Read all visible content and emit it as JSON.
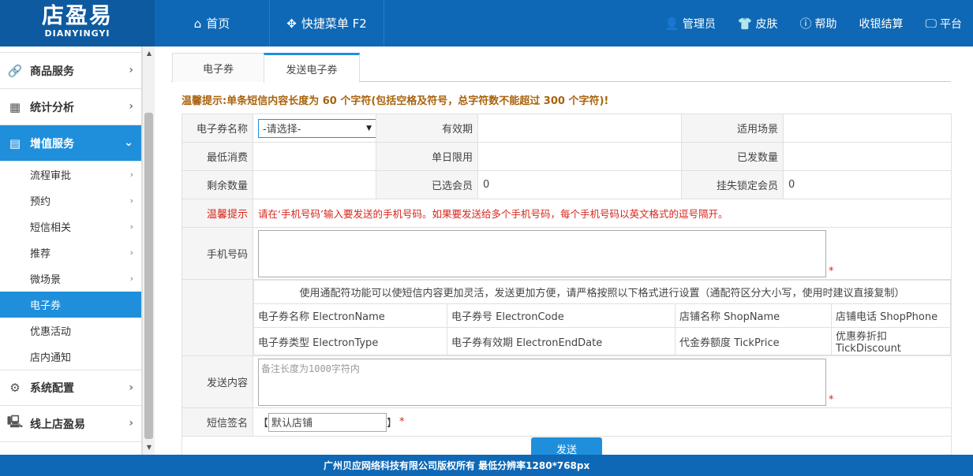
{
  "brand": {
    "name_cn": "店盈易",
    "name_en": "DIANYINGYI"
  },
  "top_nav": {
    "home": "首页",
    "quick_menu": "快捷菜单 F2"
  },
  "right_nav": {
    "admin": "管理员",
    "skin": "皮肤",
    "help": "帮助",
    "checkout": "收银结算",
    "platform": "平台"
  },
  "sidebar": {
    "groups": {
      "goods": "商品服务",
      "stats": "统计分析",
      "value_added": "增值服务",
      "system": "系统配置",
      "online": "线上店盈易"
    },
    "sub_items": [
      "流程审批",
      "预约",
      "短信相关",
      "推荐",
      "微场景",
      "电子券",
      "优惠活动",
      "店内通知"
    ]
  },
  "tabs": [
    "电子券",
    "发送电子券"
  ],
  "tip": "温馨提示:单条短信内容长度为 60 个字符(包括空格及符号，总字符数不能超过 300 个字符)!",
  "form": {
    "coupon_name_label": "电子券名称",
    "coupon_select_value": "-请选择-",
    "validity_label": "有效期",
    "scene_label": "适用场景",
    "min_spend_label": "最低消费",
    "daily_limit_label": "单日限用",
    "issued_label": "已发数量",
    "remaining_label": "剩余数量",
    "selected_members_label": "已选会员",
    "selected_members_value": "0",
    "locked_members_label": "挂失锁定会员",
    "locked_members_value": "0",
    "warm_tip_label": "温馨提示",
    "warm_tip_text": "请在‘手机号码’输入要发送的手机号码。如果要发送给多个手机号码，每个手机号码以英文格式的逗号隔开。",
    "phone_label": "手机号码",
    "required_mark": "*",
    "wildcard_head": "使用通配符功能可以使短信内容更加灵活，发送更加方便，请严格按照以下格式进行设置（通配符区分大小写，使用时建议直接复制）",
    "wildcards": [
      [
        "电子券名称 ElectronName",
        "电子券号 ElectronCode",
        "店铺名称 ShopName",
        "店铺电话 ShopPhone"
      ],
      [
        "电子券类型 ElectronType",
        "电子券有效期 ElectronEndDate",
        "代金券额度 TickPrice",
        "优惠券折扣 TickDiscount"
      ]
    ],
    "content_label": "发送内容",
    "content_placeholder": "备注长度为1000字符内",
    "signature_label": "短信签名",
    "signature_open": "【",
    "signature_value": "默认店铺",
    "signature_close": "】",
    "send_button": "发送"
  },
  "footer": "广州贝应网络科技有限公司版权所有 最低分辨率1280*768px"
}
